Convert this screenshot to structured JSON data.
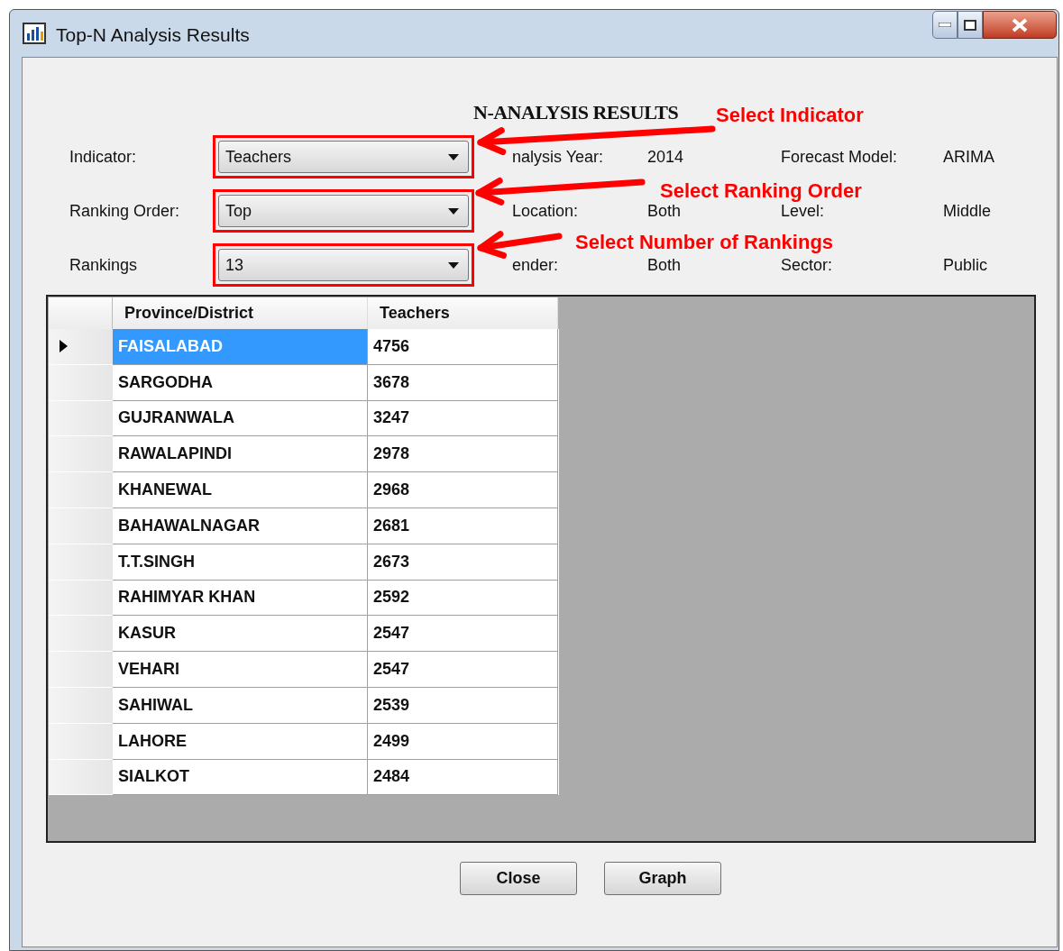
{
  "window": {
    "title": "Top-N Analysis Results"
  },
  "heading": "N-ANALYSIS RESULTS",
  "filters": [
    {
      "label": "Indicator:",
      "value": "Teachers"
    },
    {
      "label": "Ranking Order:",
      "value": "Top"
    },
    {
      "label": "Rankings",
      "value": "13"
    }
  ],
  "info": [
    [
      {
        "label": "nalysis Year:",
        "value": "2014"
      },
      {
        "label": "Forecast Model:",
        "value": "ARIMA"
      }
    ],
    [
      {
        "label": "Location:",
        "value": "Both"
      },
      {
        "label": "Level:",
        "value": "Middle"
      }
    ],
    [
      {
        "label": "ender:",
        "value": "Both"
      },
      {
        "label": "Sector:",
        "value": "Public"
      }
    ]
  ],
  "table": {
    "columns": [
      "Province/District",
      "Teachers"
    ],
    "rows": [
      {
        "cells": [
          "FAISALABAD",
          "4756"
        ],
        "selected": true
      },
      {
        "cells": [
          "SARGODHA",
          "3678"
        ],
        "selected": false
      },
      {
        "cells": [
          "GUJRANWALA",
          "3247"
        ],
        "selected": false
      },
      {
        "cells": [
          "RAWALAPINDI",
          "2978"
        ],
        "selected": false
      },
      {
        "cells": [
          "KHANEWAL",
          "2968"
        ],
        "selected": false
      },
      {
        "cells": [
          "BAHAWALNAGAR",
          "2681"
        ],
        "selected": false
      },
      {
        "cells": [
          "T.T.SINGH",
          "2673"
        ],
        "selected": false
      },
      {
        "cells": [
          "RAHIMYAR KHAN",
          "2592"
        ],
        "selected": false
      },
      {
        "cells": [
          "KASUR",
          "2547"
        ],
        "selected": false
      },
      {
        "cells": [
          "VEHARI",
          "2547"
        ],
        "selected": false
      },
      {
        "cells": [
          "SAHIWAL",
          "2539"
        ],
        "selected": false
      },
      {
        "cells": [
          "LAHORE",
          "2499"
        ],
        "selected": false
      },
      {
        "cells": [
          "SIALKOT",
          "2484"
        ],
        "selected": false
      }
    ]
  },
  "buttons": [
    "Close",
    "Graph"
  ],
  "annotations": [
    "Select Indicator",
    "Select Ranking Order",
    "Select Number of Rankings"
  ]
}
